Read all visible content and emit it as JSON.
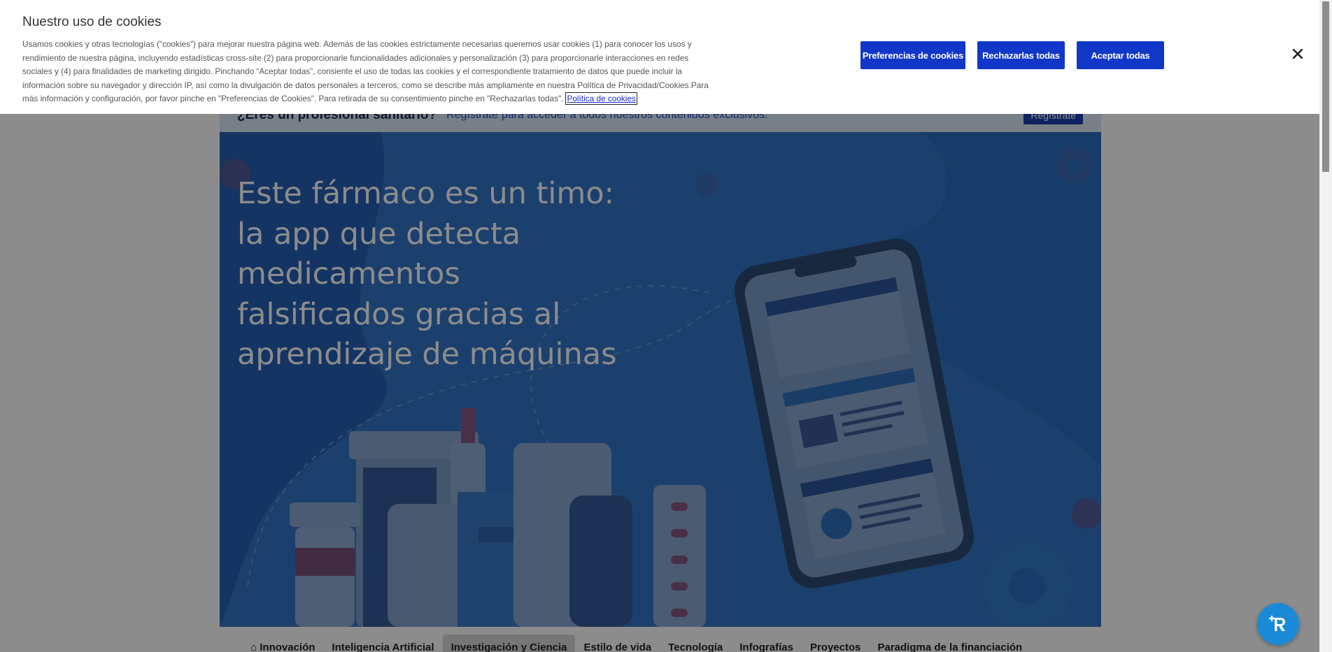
{
  "cookie_banner": {
    "title": "Nuestro uso de cookies",
    "description": "Usamos cookies y otras tecnologías (“cookies”) para mejorar nuestra página web. Además de las cookies estrictamente necesarias queremos usar cookies (1) para conocer los usos y rendimiento de nuestra página, incluyendo estadísticas cross-site (2) para proporcionarle funcionalidades adicionales y personalización (3) para proporcionarle interacciones en redes sociales y (4) para finalidades de marketing dirigido. Pinchando “Aceptar todas”, consiente el uso de todas las cookies y el correspondiente tratamiento de datos que puede incluir la información sobre su navegador y dirección IP, así como la divulgación de datos personales a terceros, como se describe más ampliamente en nuestra Política de Privacidad/Cookies.Para más información y configuración, por favor pinche en \"Preferencias de Cookies\". Para retirada de su consentimiento pinche en \"Rechazarlas todas\".",
    "policy_link": "Política de cookies",
    "buttons": {
      "preferences": "Preferencias de cookies",
      "reject": "Rechazarlas todas",
      "accept": "Aceptar todas"
    },
    "close_icon": "close-icon"
  },
  "pro_banner": {
    "question": "¿Eres un profesional sanitario?",
    "register_link": "Regístrate",
    "rest": "para acceder a todos nuestros contenidos exclusivos.",
    "register_button": "Regístrate"
  },
  "hero": {
    "title": "Este fármaco es un timo: la app que detecta medicamentos falsificados gracias al aprendizaje de máquinas"
  },
  "nav": {
    "items": [
      {
        "label": "Innovación",
        "icon": "home-icon"
      },
      {
        "label": "Inteligencia Artificial"
      },
      {
        "label": "Investigación y Ciencia",
        "active": true
      },
      {
        "label": "Estilo de vida"
      },
      {
        "label": "Tecnología"
      },
      {
        "label": "Infografías"
      },
      {
        "label": "Proyectos"
      },
      {
        "label": "Paradigma de la financiación"
      }
    ]
  },
  "assistant_button": {
    "icon": "accessibility-assistant-icon"
  },
  "colors": {
    "cookie_button": "#1137c8",
    "hero_blue": "#1a6bd6",
    "overlay": "rgba(0,0,0,0.45)"
  }
}
